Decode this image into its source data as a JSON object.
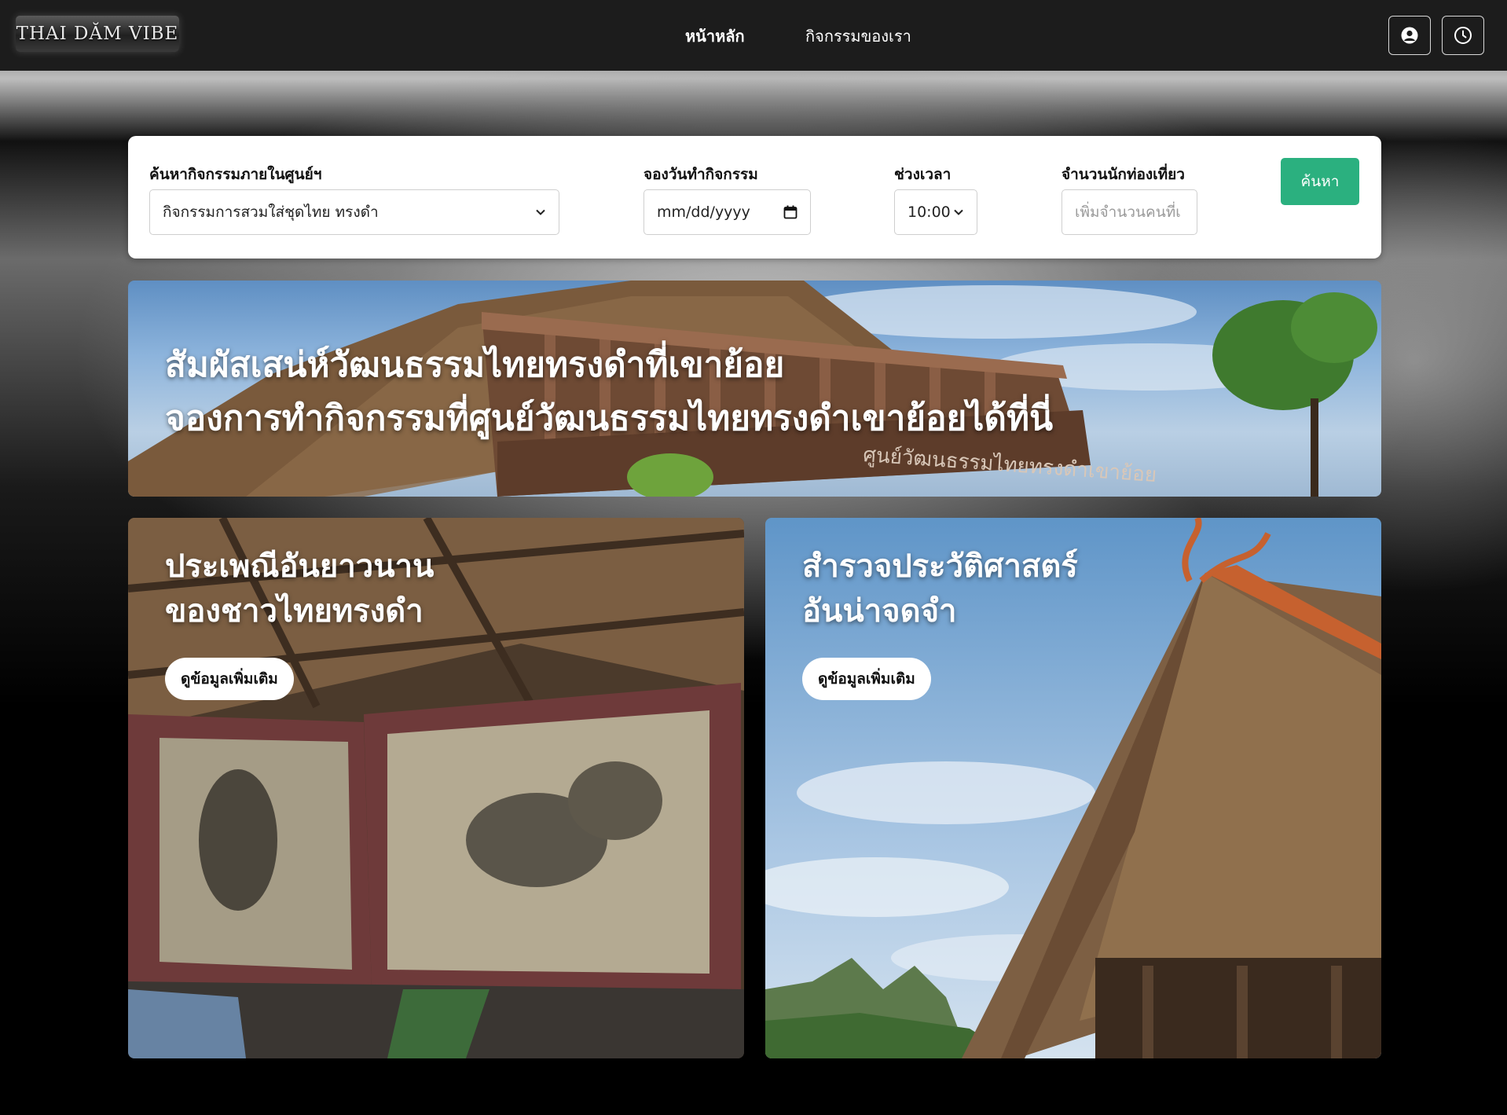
{
  "navbar": {
    "logo_text": "THAI DĂM VIBE",
    "links": [
      {
        "label": "หน้าหลัก"
      },
      {
        "label": "กิจกรรมของเรา"
      }
    ],
    "icons": [
      "user-circle-icon",
      "clock-icon"
    ]
  },
  "search": {
    "activity_label": "ค้นหากิจกรรมภายในศูนย์ฯ",
    "activity_value": "กิจกรรมการสวมใส่ชุดไทย ทรงดำ",
    "date_label": "จองวันทำกิจกรรม",
    "date_placeholder": "mm/dd/yyyy",
    "time_label": "ช่วงเวลา",
    "time_value": "10:00",
    "visitors_label": "จำนวนนักท่องเที่ยว",
    "visitors_placeholder": "เพิ่มจำนวนคนที่เ",
    "button_label": "ค้นหา"
  },
  "hero": {
    "line1": "สัมผัสเสน่ห์วัฒนธรรมไทยทรงดำที่เขาย้อย",
    "line2": "จองการทำกิจกรรมที่ศูนย์วัฒนธรรมไทยทรงดำเขาย้อยได้ที่นี่",
    "sign_text": "ศูนย์วัฒนธรรมไทยทรงดำเขาย้อย"
  },
  "cards": [
    {
      "title_line1": "ประเพณีอันยาวนาน",
      "title_line2": "ของชาวไทยทรงดำ",
      "button": "ดูข้อมูลเพิ่มเติม"
    },
    {
      "title_line1": "สำรวจประวัติศาสตร์",
      "title_line2": "อันน่าจดจำ",
      "button": "ดูข้อมูลเพิ่มเติม"
    }
  ],
  "colors": {
    "navbar": "#1c1c1c",
    "search_button": "#2bb07f",
    "card_background": "#ffffff"
  }
}
